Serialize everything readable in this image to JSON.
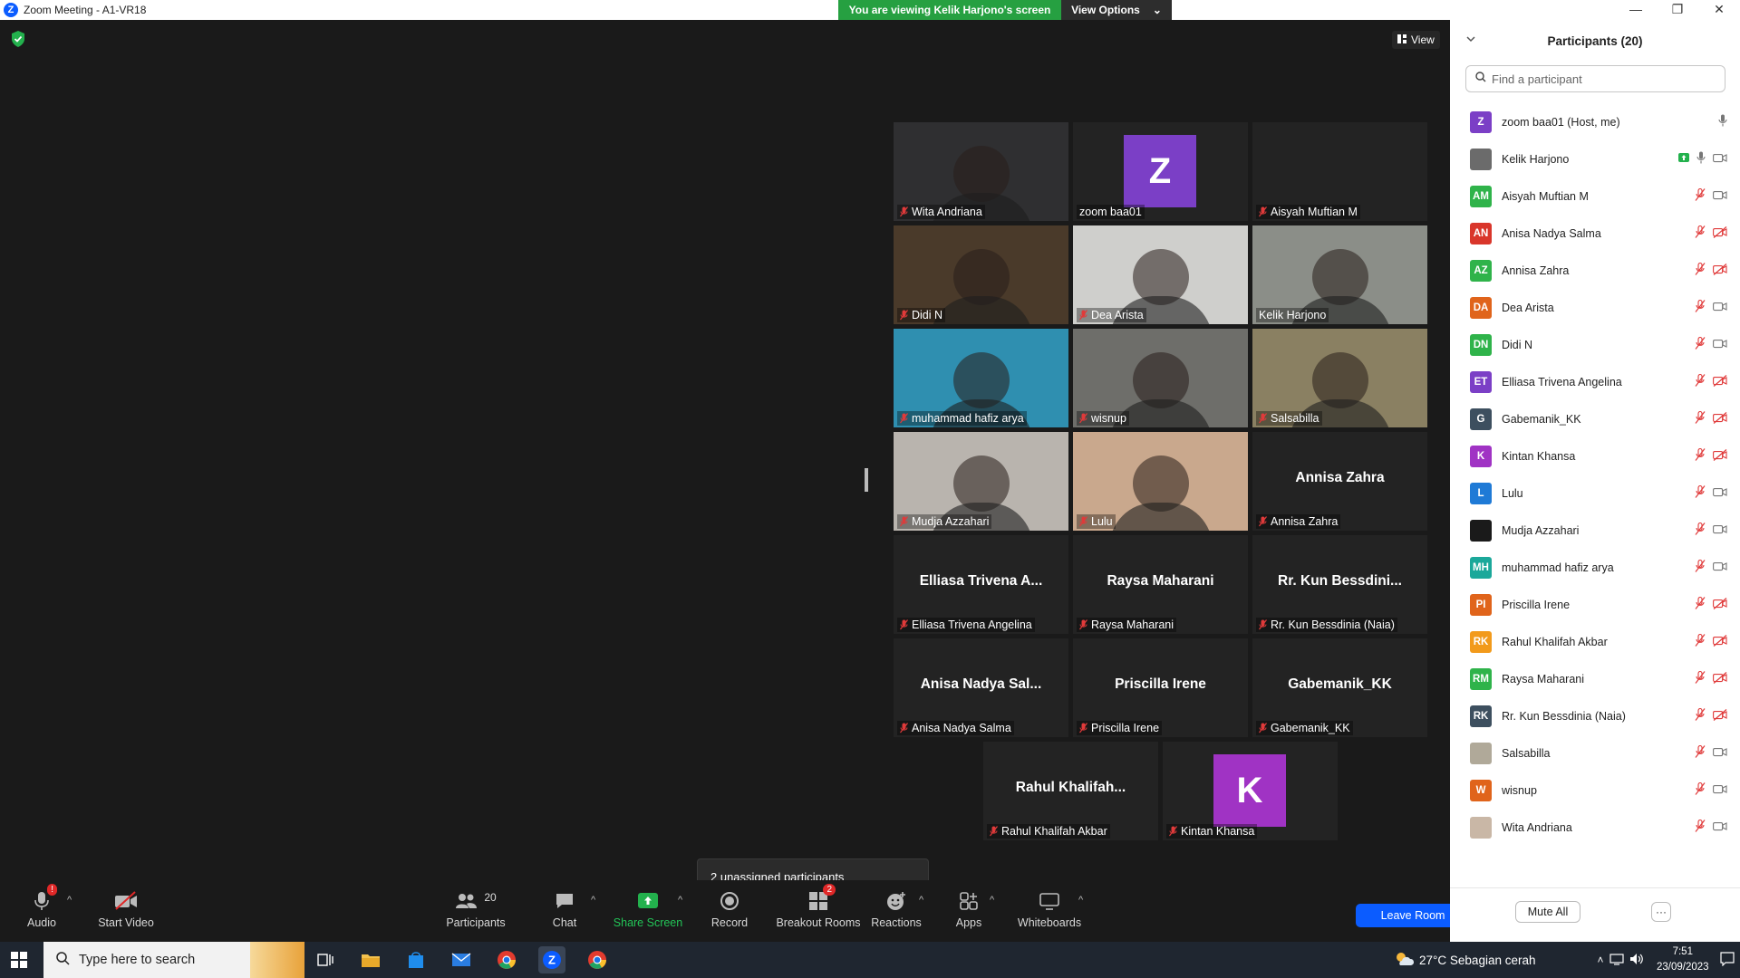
{
  "window": {
    "title": "Zoom Meeting - A1-VR18",
    "logo_letter": "Z",
    "controls": [
      "—",
      "❐",
      "✕"
    ]
  },
  "banner": {
    "viewing_text": "You are viewing Kelik Harjono's screen",
    "options_label": "View Options",
    "options_caret": "⌄"
  },
  "stage": {
    "view_label": "View",
    "unassigned_text": "2 unassigned participants"
  },
  "video_tiles": [
    {
      "name": "Wita Andriana",
      "muted": true,
      "kind": "video",
      "bg": "#2f2f31",
      "active": false
    },
    {
      "name": "zoom baa01",
      "muted": false,
      "kind": "avatar",
      "avatar_letter": "Z",
      "avatar_color": "#7b3fc6",
      "active": false
    },
    {
      "name": "Aisyah Muftian M",
      "muted": true,
      "kind": "blank",
      "active": false
    },
    {
      "name": "Didi N",
      "muted": true,
      "kind": "video",
      "bg": "#4a3a2a",
      "active": false
    },
    {
      "name": "Dea Arista",
      "muted": true,
      "kind": "video",
      "bg": "#cfcfcc",
      "active": false
    },
    {
      "name": "Kelik Harjono",
      "muted": false,
      "kind": "video",
      "bg": "#8b8e88",
      "active": true
    },
    {
      "name": "muhammad hafiz arya",
      "muted": true,
      "kind": "video",
      "bg": "#2f8fb0",
      "active": false
    },
    {
      "name": "wisnup",
      "muted": true,
      "kind": "video",
      "bg": "#6e6e6a",
      "active": false
    },
    {
      "name": "Salsabilla",
      "muted": true,
      "kind": "video",
      "bg": "#8a8062",
      "active": false
    },
    {
      "name": "Mudja Azzahari",
      "muted": true,
      "kind": "video",
      "bg": "#b9b4ae",
      "active": false
    },
    {
      "name": "Lulu",
      "muted": true,
      "kind": "video",
      "bg": "#c9a88d",
      "active": false
    },
    {
      "name": "Annisa Zahra",
      "muted": true,
      "kind": "text",
      "display": "Annisa Zahra",
      "active": false
    },
    {
      "name": "Elliasa Trivena Angelina",
      "muted": true,
      "kind": "text",
      "display": "Elliasa  Trivena  A...",
      "active": false
    },
    {
      "name": "Raysa Maharani",
      "muted": true,
      "kind": "text",
      "display": "Raysa Maharani",
      "active": false
    },
    {
      "name": "Rr. Kun Bessdinia (Naia)",
      "muted": true,
      "kind": "text",
      "display": "Rr.  Kun  Bessdini...",
      "active": false
    },
    {
      "name": "Anisa Nadya Salma",
      "muted": true,
      "kind": "text",
      "display": "Anisa  Nadya  Sal...",
      "active": false
    },
    {
      "name": "Priscilla Irene",
      "muted": true,
      "kind": "text",
      "display": "Priscilla Irene",
      "active": false
    },
    {
      "name": "Gabemanik_KK",
      "muted": true,
      "kind": "text",
      "display": "Gabemanik_KK",
      "active": false
    },
    {
      "name": "Rahul Khalifah Akbar",
      "muted": true,
      "kind": "text",
      "display": "Rahul  Khalifah...",
      "active": false
    },
    {
      "name": "Kintan Khansa",
      "muted": true,
      "kind": "avatar",
      "avatar_letter": "K",
      "avatar_color": "#a033c4",
      "active": false
    }
  ],
  "toolbar": {
    "audio_label": "Audio",
    "audio_badge": "!",
    "video_label": "Start Video",
    "participants_label": "Participants",
    "participants_count": "20",
    "chat_label": "Chat",
    "share_label": "Share Screen",
    "record_label": "Record",
    "breakout_label": "Breakout Rooms",
    "breakout_badge": "2",
    "reactions_label": "Reactions",
    "apps_label": "Apps",
    "whiteboards_label": "Whiteboards",
    "leave_label": "Leave Room",
    "caret": "^"
  },
  "panel": {
    "title": "Participants (20)",
    "search_placeholder": "Find a participant",
    "mute_all_label": "Mute All",
    "more_label": "···",
    "participants": [
      {
        "name": "zoom baa01 (Host, me)",
        "initials": "Z",
        "color": "#7b3fc6",
        "mic": "on",
        "video": "none"
      },
      {
        "name": "Kelik Harjono",
        "initials": "",
        "color": "#6b6b6b",
        "mic": "on",
        "video": "on",
        "sharing": true
      },
      {
        "name": "Aisyah Muftian M",
        "initials": "AM",
        "color": "#2fb34a",
        "mic": "muted",
        "video": "on"
      },
      {
        "name": "Anisa Nadya Salma",
        "initials": "AN",
        "color": "#d9362b",
        "mic": "muted",
        "video": "off"
      },
      {
        "name": "Annisa Zahra",
        "initials": "AZ",
        "color": "#2fb34a",
        "mic": "muted",
        "video": "off"
      },
      {
        "name": "Dea Arista",
        "initials": "DA",
        "color": "#e0641b",
        "mic": "muted",
        "video": "on"
      },
      {
        "name": "Didi N",
        "initials": "DN",
        "color": "#2fb34a",
        "mic": "muted",
        "video": "on"
      },
      {
        "name": "Elliasa Trivena Angelina",
        "initials": "ET",
        "color": "#7b3fc6",
        "mic": "muted",
        "video": "off"
      },
      {
        "name": "Gabemanik_KK",
        "initials": "G",
        "color": "#3d4f5f",
        "mic": "muted",
        "video": "off"
      },
      {
        "name": "Kintan Khansa",
        "initials": "K",
        "color": "#a033c4",
        "mic": "muted",
        "video": "off"
      },
      {
        "name": "Lulu",
        "initials": "L",
        "color": "#1f7ad6",
        "mic": "muted",
        "video": "on"
      },
      {
        "name": "Mudja Azzahari",
        "initials": "",
        "color": "#1a1a1a",
        "mic": "muted",
        "video": "on"
      },
      {
        "name": "muhammad hafiz arya",
        "initials": "MH",
        "color": "#1ba89a",
        "mic": "muted",
        "video": "on"
      },
      {
        "name": "Priscilla Irene",
        "initials": "PI",
        "color": "#e0641b",
        "mic": "muted",
        "video": "off"
      },
      {
        "name": "Rahul Khalifah Akbar",
        "initials": "RK",
        "color": "#f29a1b",
        "mic": "muted",
        "video": "off"
      },
      {
        "name": "Raysa Maharani",
        "initials": "RM",
        "color": "#2fb34a",
        "mic": "muted",
        "video": "off"
      },
      {
        "name": "Rr. Kun Bessdinia (Naia)",
        "initials": "RK",
        "color": "#3d4f5f",
        "mic": "muted",
        "video": "off"
      },
      {
        "name": "Salsabilla",
        "initials": "",
        "color": "#b0a999",
        "mic": "muted",
        "video": "on"
      },
      {
        "name": "wisnup",
        "initials": "W",
        "color": "#e0641b",
        "mic": "muted",
        "video": "on"
      },
      {
        "name": "Wita Andriana",
        "initials": "",
        "color": "#c9b7a6",
        "mic": "muted",
        "video": "on"
      }
    ]
  },
  "taskbar": {
    "search_placeholder": "Type here to search",
    "weather": "27°C  Sebagian cerah",
    "time": "7:51",
    "date": "23/09/2023"
  }
}
